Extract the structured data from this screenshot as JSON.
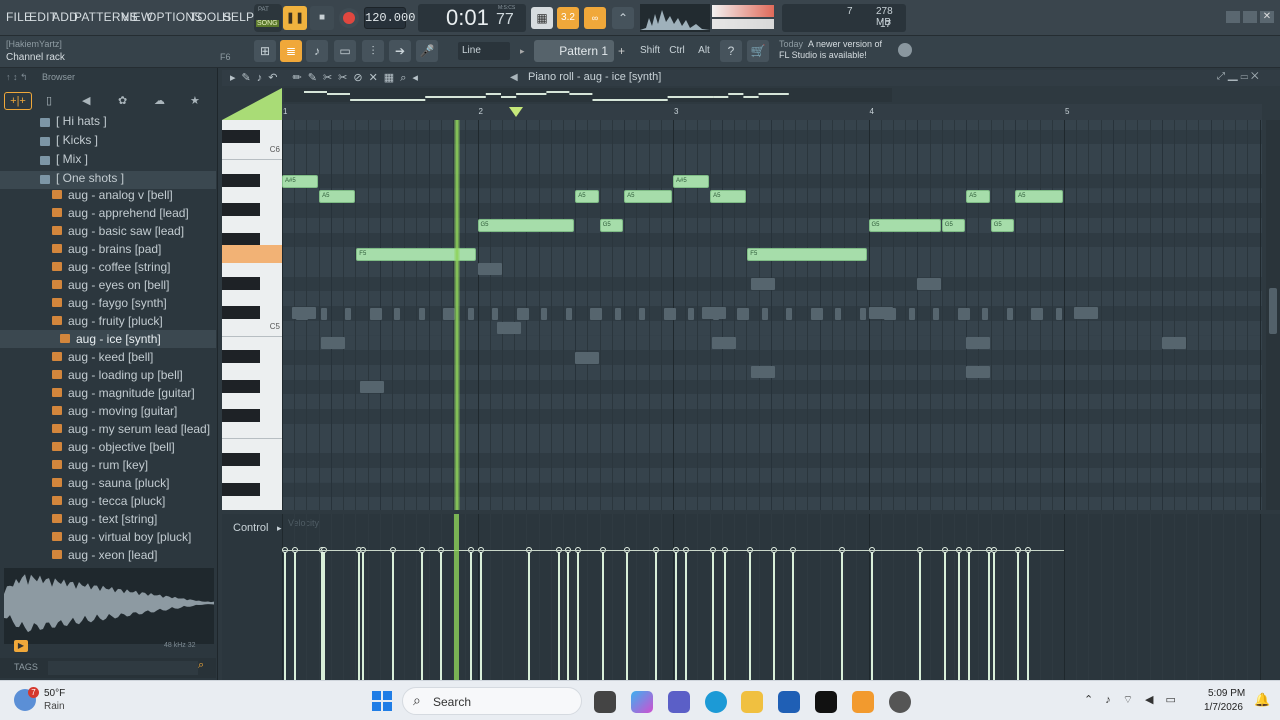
{
  "menu": [
    "FILE",
    "EDIT",
    "ADD",
    "PATTERNS",
    "VIEW",
    "OPTIONS",
    "TOOLS",
    "HELP"
  ],
  "transport": {
    "pat_label": "PAT",
    "song_label": "SONG",
    "tempo": "120.000",
    "time": "0:01",
    "time_frac": "77",
    "time_unit": "M:S:CS",
    "snap_display": "3.2"
  },
  "cpu": {
    "val1": "7",
    "mem": "278 MB",
    "val2": "17"
  },
  "hint": {
    "user": "[HakiemYartz]",
    "context": "Channel rack",
    "shortcut": "F6"
  },
  "toolbar": {
    "snap_mode": "Line",
    "pattern": "Pattern 1",
    "shift": "Shift",
    "ctrl": "Ctrl",
    "alt": "Alt"
  },
  "news": {
    "line1": "Today",
    "line2": "A newer version of",
    "line3": "FL Studio is available!"
  },
  "browser": {
    "title": "Browser",
    "folders": [
      "[ Hi hats ]",
      "[ Kicks ]",
      "[ Mix ]",
      "[ One shots ]"
    ],
    "items": [
      "aug - analog v [bell]",
      "aug - apprehend [lead]",
      "aug - basic saw [lead]",
      "aug - brains [pad]",
      "aug - coffee [string]",
      "aug - eyes on [bell]",
      "aug - faygo [synth]",
      "aug - fruity [pluck]",
      "aug - ice [synth]",
      "aug - keed [bell]",
      "aug - loading up [bell]",
      "aug - magnitude [guitar]",
      "aug - moving [guitar]",
      "aug - my serum lead [lead]",
      "aug - objective [bell]",
      "aug - rum [key]",
      "aug - sauna [pluck]",
      "aug - tecca [pluck]",
      "aug - text [string]",
      "aug - virtual boy [pluck]",
      "aug - xeon [lead]"
    ],
    "selected_index": 8,
    "sample_rate": "48 kHz 32",
    "tags_label": "TAGS"
  },
  "pianoroll": {
    "title": "Piano roll - aug - ice [synth]",
    "bar_numbers": [
      "1",
      "2",
      "3",
      "4",
      "5"
    ],
    "key_labels": [
      "C6",
      "C5"
    ],
    "control_label": "Control",
    "velocity_label": "Velocity",
    "notes": [
      {
        "label": "A#5",
        "start": 0.0,
        "len": 0.19,
        "pitch": "A#5"
      },
      {
        "label": "A5",
        "start": 0.19,
        "len": 0.19,
        "pitch": "A5"
      },
      {
        "label": "F5",
        "start": 0.38,
        "len": 0.62,
        "pitch": "F5"
      },
      {
        "label": "G5",
        "start": 1.0,
        "len": 0.5,
        "pitch": "G5"
      },
      {
        "label": "A5",
        "start": 1.5,
        "len": 0.125,
        "pitch": "A5"
      },
      {
        "label": "G5",
        "start": 1.625,
        "len": 0.125,
        "pitch": "G5"
      },
      {
        "label": "A5",
        "start": 1.75,
        "len": 0.25,
        "pitch": "A5"
      },
      {
        "label": "A#5",
        "start": 2.0,
        "len": 0.19,
        "pitch": "A#5"
      },
      {
        "label": "A5",
        "start": 2.19,
        "len": 0.19,
        "pitch": "A5"
      },
      {
        "label": "F5",
        "start": 2.38,
        "len": 0.62,
        "pitch": "F5"
      },
      {
        "label": "G5",
        "start": 3.0,
        "len": 0.375,
        "pitch": "G5"
      },
      {
        "label": "G5",
        "start": 3.375,
        "len": 0.125,
        "pitch": "G5"
      },
      {
        "label": "A5",
        "start": 3.5,
        "len": 0.125,
        "pitch": "A5"
      },
      {
        "label": "G5",
        "start": 3.625,
        "len": 0.125,
        "pitch": "G5"
      },
      {
        "label": "A5",
        "start": 3.75,
        "len": 0.25,
        "pitch": "A5"
      }
    ],
    "playhead_bar": 1.88
  },
  "taskbar": {
    "weather_temp": "50°F",
    "weather_desc": "Rain",
    "weather_badge": "7",
    "search": "Search",
    "time": "5:09 PM",
    "date": "1/7/2026"
  }
}
